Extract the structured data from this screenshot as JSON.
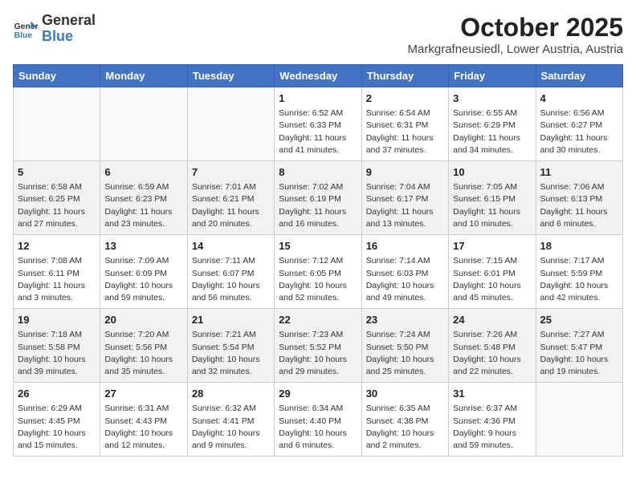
{
  "logo": {
    "general": "General",
    "blue": "Blue"
  },
  "header": {
    "month": "October 2025",
    "location": "Markgrafneusiedl, Lower Austria, Austria"
  },
  "weekdays": [
    "Sunday",
    "Monday",
    "Tuesday",
    "Wednesday",
    "Thursday",
    "Friday",
    "Saturday"
  ],
  "weeks": [
    [
      {
        "day": "",
        "info": ""
      },
      {
        "day": "",
        "info": ""
      },
      {
        "day": "",
        "info": ""
      },
      {
        "day": "1",
        "info": "Sunrise: 6:52 AM\nSunset: 6:33 PM\nDaylight: 11 hours\nand 41 minutes."
      },
      {
        "day": "2",
        "info": "Sunrise: 6:54 AM\nSunset: 6:31 PM\nDaylight: 11 hours\nand 37 minutes."
      },
      {
        "day": "3",
        "info": "Sunrise: 6:55 AM\nSunset: 6:29 PM\nDaylight: 11 hours\nand 34 minutes."
      },
      {
        "day": "4",
        "info": "Sunrise: 6:56 AM\nSunset: 6:27 PM\nDaylight: 11 hours\nand 30 minutes."
      }
    ],
    [
      {
        "day": "5",
        "info": "Sunrise: 6:58 AM\nSunset: 6:25 PM\nDaylight: 11 hours\nand 27 minutes."
      },
      {
        "day": "6",
        "info": "Sunrise: 6:59 AM\nSunset: 6:23 PM\nDaylight: 11 hours\nand 23 minutes."
      },
      {
        "day": "7",
        "info": "Sunrise: 7:01 AM\nSunset: 6:21 PM\nDaylight: 11 hours\nand 20 minutes."
      },
      {
        "day": "8",
        "info": "Sunrise: 7:02 AM\nSunset: 6:19 PM\nDaylight: 11 hours\nand 16 minutes."
      },
      {
        "day": "9",
        "info": "Sunrise: 7:04 AM\nSunset: 6:17 PM\nDaylight: 11 hours\nand 13 minutes."
      },
      {
        "day": "10",
        "info": "Sunrise: 7:05 AM\nSunset: 6:15 PM\nDaylight: 11 hours\nand 10 minutes."
      },
      {
        "day": "11",
        "info": "Sunrise: 7:06 AM\nSunset: 6:13 PM\nDaylight: 11 hours\nand 6 minutes."
      }
    ],
    [
      {
        "day": "12",
        "info": "Sunrise: 7:08 AM\nSunset: 6:11 PM\nDaylight: 11 hours\nand 3 minutes."
      },
      {
        "day": "13",
        "info": "Sunrise: 7:09 AM\nSunset: 6:09 PM\nDaylight: 10 hours\nand 59 minutes."
      },
      {
        "day": "14",
        "info": "Sunrise: 7:11 AM\nSunset: 6:07 PM\nDaylight: 10 hours\nand 56 minutes."
      },
      {
        "day": "15",
        "info": "Sunrise: 7:12 AM\nSunset: 6:05 PM\nDaylight: 10 hours\nand 52 minutes."
      },
      {
        "day": "16",
        "info": "Sunrise: 7:14 AM\nSunset: 6:03 PM\nDaylight: 10 hours\nand 49 minutes."
      },
      {
        "day": "17",
        "info": "Sunrise: 7:15 AM\nSunset: 6:01 PM\nDaylight: 10 hours\nand 45 minutes."
      },
      {
        "day": "18",
        "info": "Sunrise: 7:17 AM\nSunset: 5:59 PM\nDaylight: 10 hours\nand 42 minutes."
      }
    ],
    [
      {
        "day": "19",
        "info": "Sunrise: 7:18 AM\nSunset: 5:58 PM\nDaylight: 10 hours\nand 39 minutes."
      },
      {
        "day": "20",
        "info": "Sunrise: 7:20 AM\nSunset: 5:56 PM\nDaylight: 10 hours\nand 35 minutes."
      },
      {
        "day": "21",
        "info": "Sunrise: 7:21 AM\nSunset: 5:54 PM\nDaylight: 10 hours\nand 32 minutes."
      },
      {
        "day": "22",
        "info": "Sunrise: 7:23 AM\nSunset: 5:52 PM\nDaylight: 10 hours\nand 29 minutes."
      },
      {
        "day": "23",
        "info": "Sunrise: 7:24 AM\nSunset: 5:50 PM\nDaylight: 10 hours\nand 25 minutes."
      },
      {
        "day": "24",
        "info": "Sunrise: 7:26 AM\nSunset: 5:48 PM\nDaylight: 10 hours\nand 22 minutes."
      },
      {
        "day": "25",
        "info": "Sunrise: 7:27 AM\nSunset: 5:47 PM\nDaylight: 10 hours\nand 19 minutes."
      }
    ],
    [
      {
        "day": "26",
        "info": "Sunrise: 6:29 AM\nSunset: 4:45 PM\nDaylight: 10 hours\nand 15 minutes."
      },
      {
        "day": "27",
        "info": "Sunrise: 6:31 AM\nSunset: 4:43 PM\nDaylight: 10 hours\nand 12 minutes."
      },
      {
        "day": "28",
        "info": "Sunrise: 6:32 AM\nSunset: 4:41 PM\nDaylight: 10 hours\nand 9 minutes."
      },
      {
        "day": "29",
        "info": "Sunrise: 6:34 AM\nSunset: 4:40 PM\nDaylight: 10 hours\nand 6 minutes."
      },
      {
        "day": "30",
        "info": "Sunrise: 6:35 AM\nSunset: 4:38 PM\nDaylight: 10 hours\nand 2 minutes."
      },
      {
        "day": "31",
        "info": "Sunrise: 6:37 AM\nSunset: 4:36 PM\nDaylight: 9 hours\nand 59 minutes."
      },
      {
        "day": "",
        "info": ""
      }
    ]
  ]
}
